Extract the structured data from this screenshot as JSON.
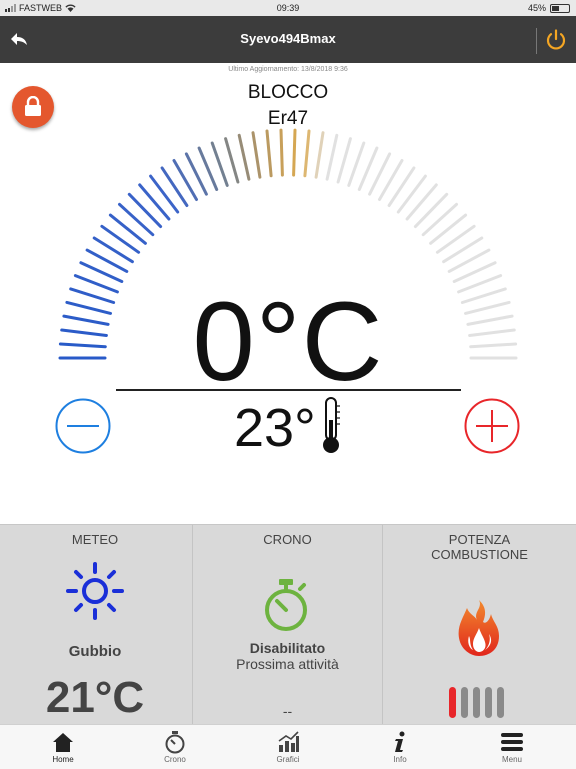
{
  "status_bar": {
    "carrier": "FASTWEB",
    "time": "09:39",
    "battery": "45%",
    "battery_level": 0.45
  },
  "nav": {
    "title": "Syevo494Bmax",
    "back_icon": "back-arrow-icon",
    "power_icon": "power-icon",
    "power_color": "#f5a623"
  },
  "main": {
    "last_update": "Ultimo Aggiornamento: 13/8/2018 9:36",
    "status_line1": "BLOCCO",
    "status_line2": "Er47",
    "set_temp": "0°C",
    "room_temp": "23°",
    "lock_icon": "lock-icon",
    "lock_color": "#e4572e",
    "minus_color": "#1e7fe0",
    "plus_color": "#e8262a"
  },
  "panels": {
    "meteo": {
      "title": "METEO",
      "city": "Gubbio",
      "temp": "21°C",
      "icon": "sun-icon",
      "icon_color": "#1a2fd8"
    },
    "crono": {
      "title": "CRONO",
      "state": "Disabilitato",
      "next_label": "Prossima attività",
      "next_value": "--",
      "icon": "stopwatch-icon",
      "icon_color": "#6db33f"
    },
    "potenza": {
      "title": "POTENZA\nCOMBUSTIONE",
      "icon": "flame-icon",
      "level": 1,
      "max_level": 5
    }
  },
  "tabs": [
    {
      "label": "Home",
      "icon": "home-icon"
    },
    {
      "label": "Crono",
      "icon": "stopwatch-icon"
    },
    {
      "label": "Grafici",
      "icon": "chart-icon"
    },
    {
      "label": "Info",
      "icon": "info-icon"
    },
    {
      "label": "Menu",
      "icon": "menu-icon"
    }
  ]
}
